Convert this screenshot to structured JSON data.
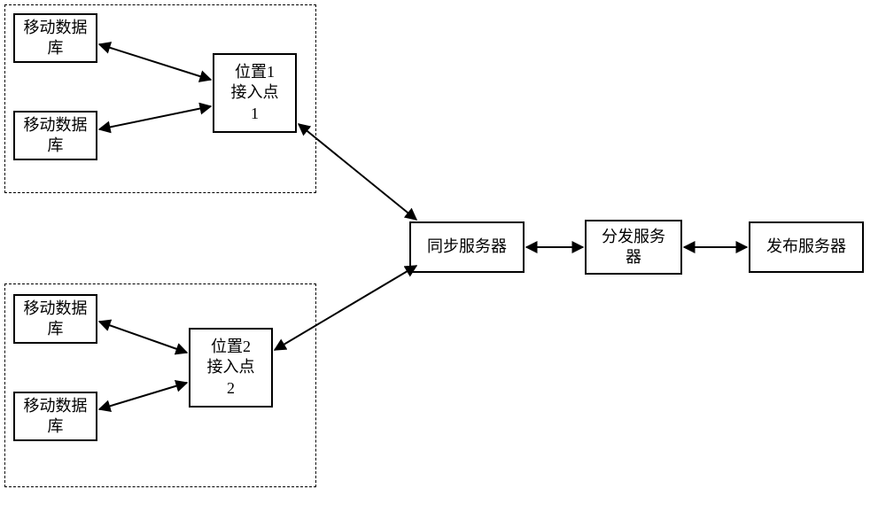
{
  "nodes": {
    "db1a": "移动数据\n库",
    "db1b": "移动数据\n库",
    "ap1": "位置1\n接入点\n1",
    "db2a": "移动数据\n库",
    "db2b": "移动数据\n库",
    "ap2": "位置2\n接入点\n2",
    "sync": "同步服务器",
    "dist": "分发服务\n器",
    "pub": "发布服务器"
  }
}
